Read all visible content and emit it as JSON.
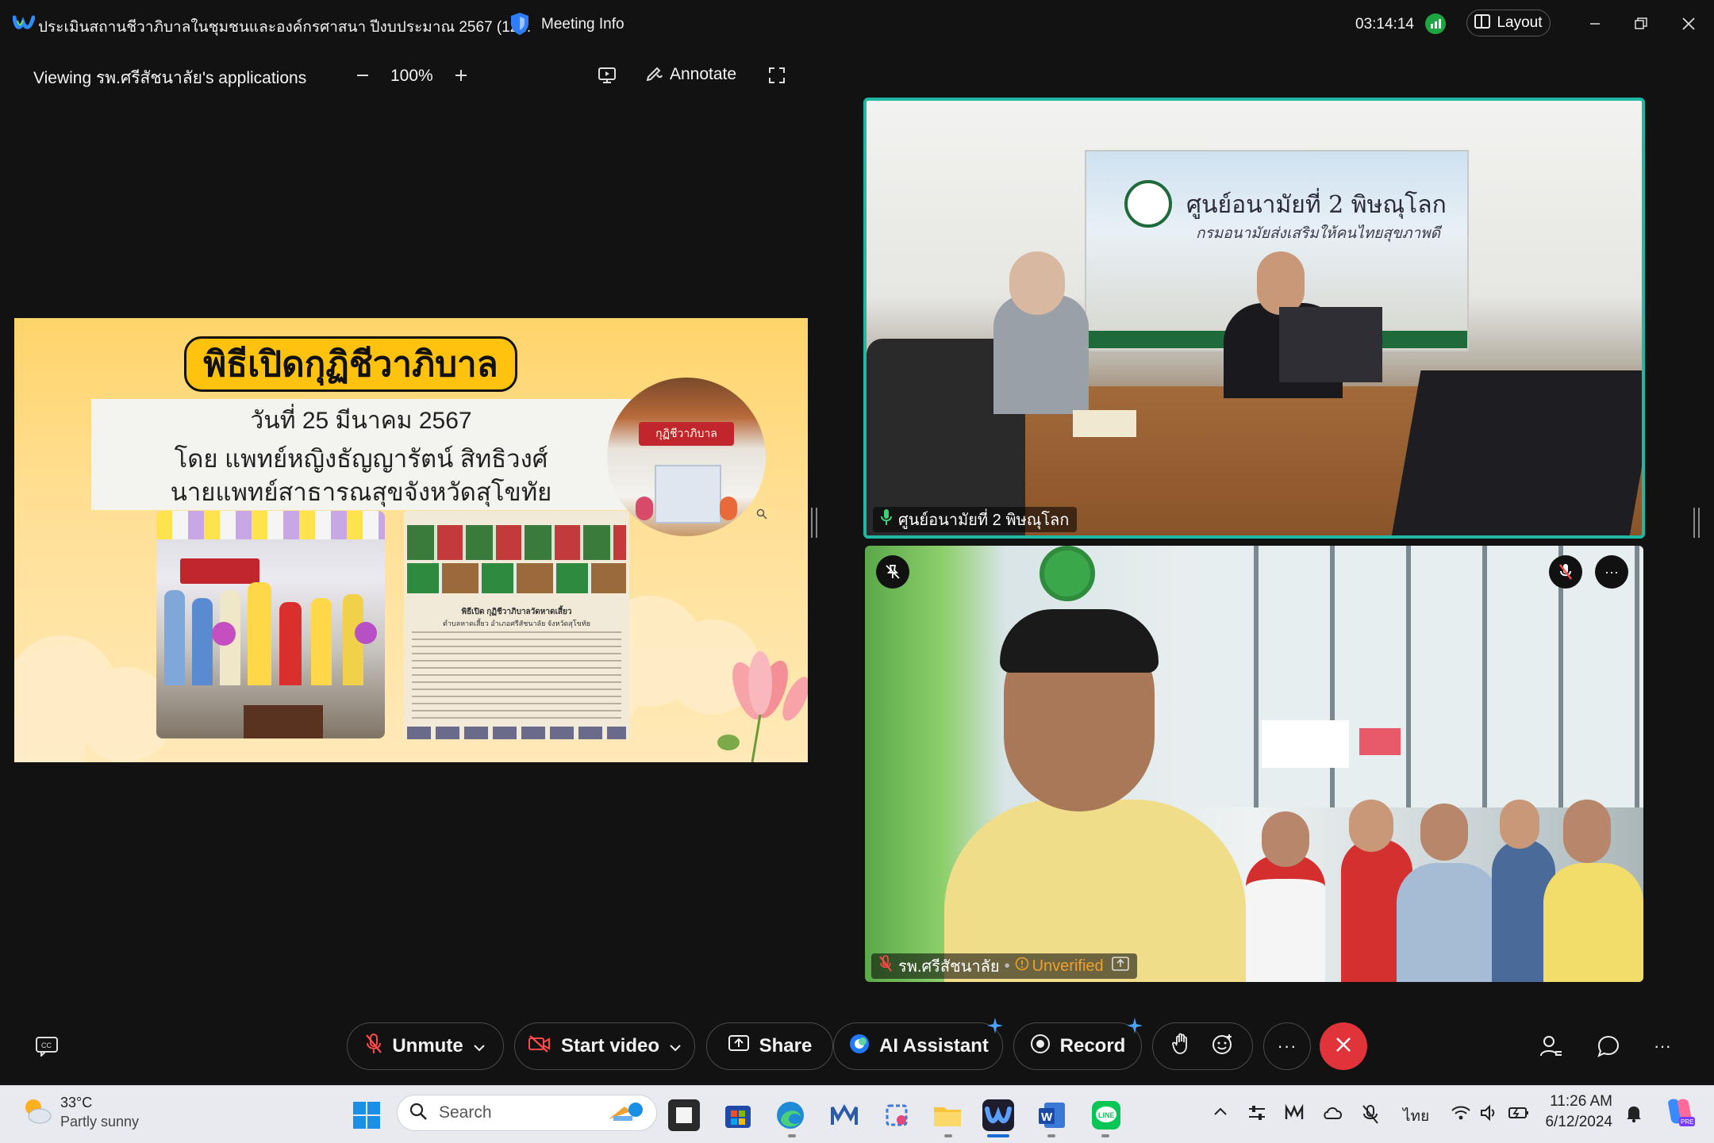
{
  "window": {
    "title": "ประเมินสถานชีวาภิบาลในชุมชนและองค์กรศาสนา ปีงบประมาณ 2567 (12...",
    "meeting_info_label": "Meeting Info",
    "timer": "03:14:14",
    "layout_label": "Layout"
  },
  "share_bar": {
    "viewing_label": "Viewing รพ.ศรีสัชนาลัย's applications",
    "zoom_value": "100%",
    "annotate_label": "Annotate"
  },
  "slide": {
    "title": "พิธีเปิดกุฏิชีวาภิบาล",
    "date_line": "วันที่ 25 มีนาคม 2567",
    "by_line": "โดย แพทย์หญิงธัญญารัตน์ สิทธิวงศ์",
    "role_line": "นายแพทย์สาธารณสุขจังหวัดสุโขทัย",
    "banner_text": "กุฏิชีวาภิบาล",
    "document_heading": "พิธีเปิด กุฏิชีวาภิบาลวัดหาดเสี้ยว",
    "document_sub": "ตำบลหาดเสี้ยว อำเภอศรีสัชนาลัย จังหวัดสุโขทัย"
  },
  "video_top": {
    "name": "ศูนย์อนามัยที่ 2 พิษณุโลก",
    "sign_main": "ศูนย์อนามัยที่ 2 พิษณุโลก",
    "sign_sub": "กรมอนามัยส่งเสริมให้คนไทยสุขภาพดี"
  },
  "video_bottom": {
    "name": "รพ.ศรีสัชนาลัย",
    "unverified_label": "Unverified"
  },
  "controls": {
    "unmute_label": "Unmute",
    "start_video_label": "Start video",
    "share_label": "Share",
    "ai_assistant_label": "AI Assistant",
    "record_label": "Record",
    "more_label": "···"
  },
  "taskbar": {
    "temperature": "33°C",
    "weather": "Partly sunny",
    "search_placeholder": "Search",
    "language": "ไทย",
    "time": "11:26 AM",
    "date": "6/12/2024"
  },
  "colors": {
    "accent_blue": "#0a84ff",
    "end_call_red": "#e0333a",
    "active_speaker_border": "#1fb8a4",
    "unverified_orange": "#f0a030",
    "slide_title_fill": "#ffc20e"
  }
}
